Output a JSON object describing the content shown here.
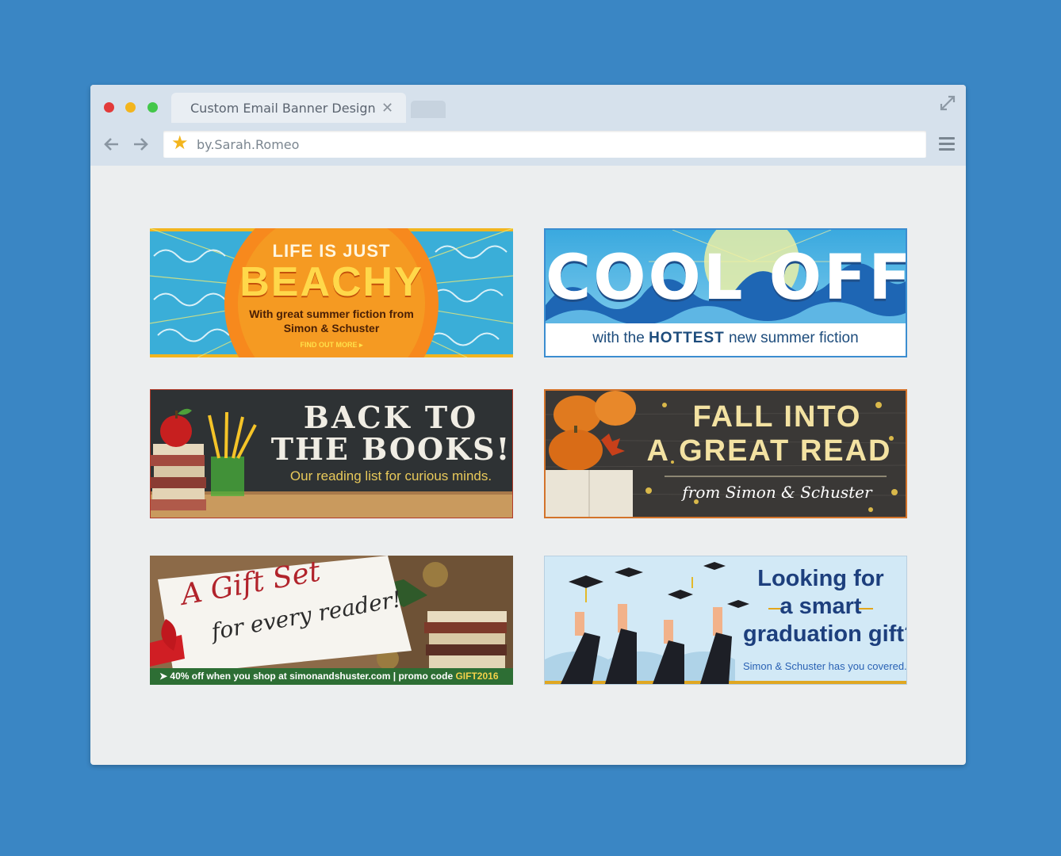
{
  "browser": {
    "tab_title": "Custom Email Banner Design",
    "url": "by.Sarah.Romeo",
    "traffic_lights": [
      "#e23a3a",
      "#f3b51d",
      "#43c74a"
    ]
  },
  "banners": {
    "beachy": {
      "line1": "LIFE IS JUST",
      "line2": "BEACHY",
      "sub1": "With great summer fiction from",
      "sub2": "Simon & Schuster",
      "cta": "FIND OUT MORE ▸"
    },
    "cool_off": {
      "headline": "COOL OFF",
      "sub_pre": "with the ",
      "sub_bold": "HOTTEST",
      "sub_post": " new summer fiction"
    },
    "back_to_books": {
      "line1": "BACK TO",
      "line2": "THE BOOKS!",
      "sub": "Our reading list for curious minds."
    },
    "fall": {
      "line1": "FALL INTO",
      "line2": "A GREAT READ",
      "sub": "from Simon & Schuster"
    },
    "gift": {
      "line1": "A Gift Set",
      "line2": "for every reader!",
      "promo": "➤ 40% off when you shop at simonandshuster.com | promo code ",
      "code": "GIFT2016"
    },
    "graduation": {
      "line1": "Looking for",
      "line2": "a smart",
      "line3": "graduation gift?",
      "sub": "Simon & Schuster has you covered."
    }
  }
}
